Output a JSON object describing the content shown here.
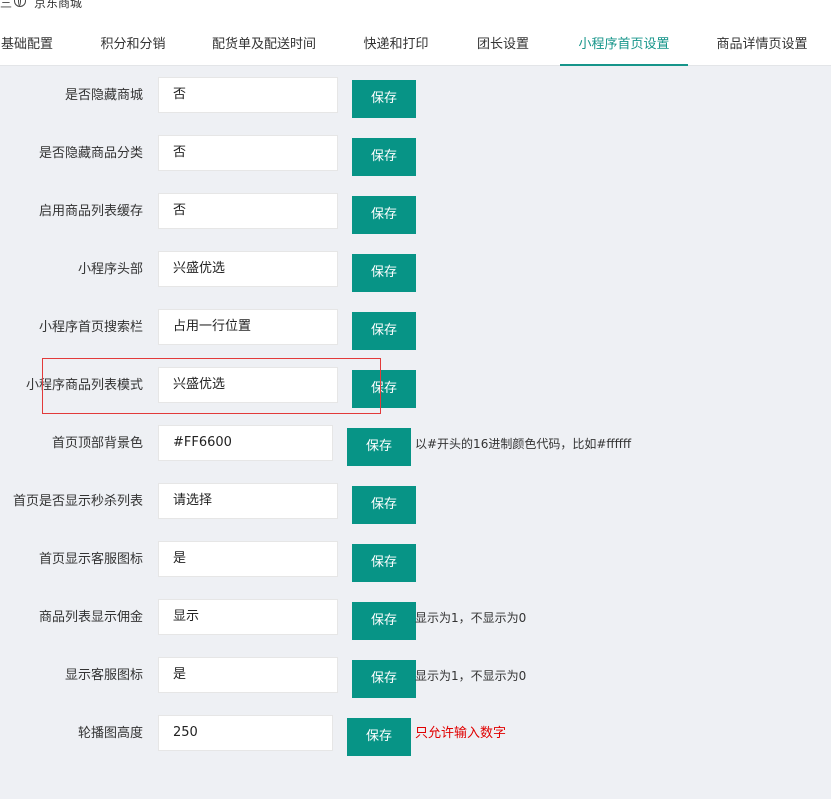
{
  "browser": {
    "tab_title": "京东商城",
    "top_mark": "三"
  },
  "tabs": [
    "基础配置",
    "积分和分销",
    "配货单及配送时间",
    "快递和打印",
    "团长设置",
    "小程序首页设置",
    "商品详情页设置"
  ],
  "active_tab": 5,
  "rows": [
    {
      "label": "是否隐藏商城",
      "value": "否",
      "button": "保存",
      "hint": ""
    },
    {
      "label": "是否隐藏商品分类",
      "value": "否",
      "button": "保存",
      "hint": ""
    },
    {
      "label": "启用商品列表缓存",
      "value": "否",
      "button": "保存",
      "hint": ""
    },
    {
      "label": "小程序头部",
      "value": "兴盛优选",
      "button": "保存",
      "hint": ""
    },
    {
      "label": "小程序首页搜索栏",
      "value": "占用一行位置",
      "button": "保存",
      "hint": ""
    },
    {
      "label": "小程序商品列表模式",
      "value": "兴盛优选",
      "button": "保存",
      "hint": ""
    },
    {
      "label": "首页顶部背景色",
      "value": "#FF6600",
      "button": "保存",
      "hint": "以#开头的16进制颜色代码，比如#ffffff"
    },
    {
      "label": "首页是否显示秒杀列表",
      "value": "请选择",
      "button": "保存",
      "hint": ""
    },
    {
      "label": "首页显示客服图标",
      "value": "是",
      "button": "保存",
      "hint": ""
    },
    {
      "label": "商品列表显示佣金",
      "value": "显示",
      "button": "保存",
      "hint": "显示为1，不显示为0"
    },
    {
      "label": "显示客服图标",
      "value": "是",
      "button": "保存",
      "hint": "显示为1，不显示为0"
    },
    {
      "label": "轮播图高度",
      "value": "250",
      "button": "保存",
      "hint": "只允许输入数字"
    }
  ],
  "colors": {
    "accent": "#16958a",
    "button": "#079486",
    "warning_text": "#e00000"
  }
}
